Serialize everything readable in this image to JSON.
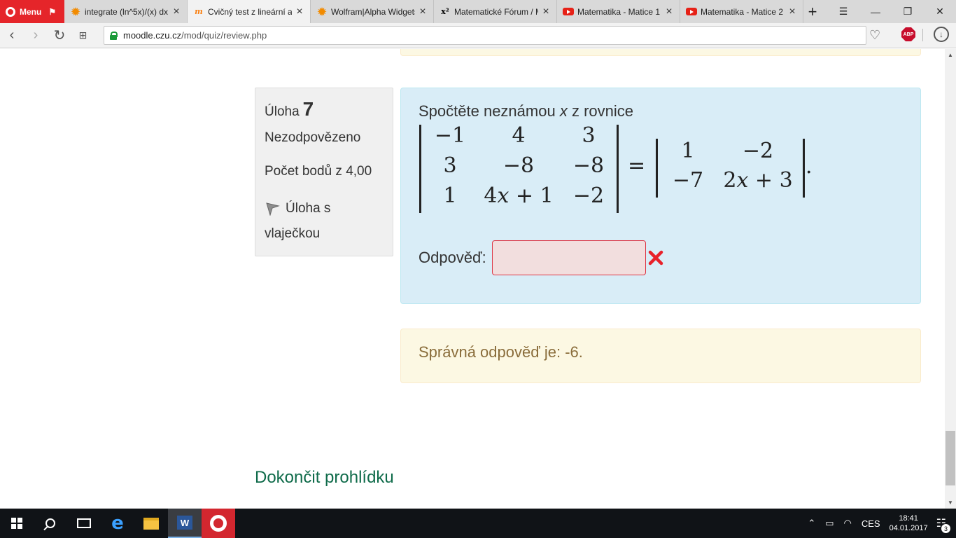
{
  "browser": {
    "menu_label": "Menu",
    "tabs": [
      {
        "title": "integrate (ln^5x)/(x) dx",
        "icon": "wolfram-sun-icon"
      },
      {
        "title": "Cvičný test z lineární algebry",
        "icon": "moodle-icon",
        "active": true
      },
      {
        "title": "Wolfram|Alpha Widgets",
        "icon": "wolfram-sun-icon"
      },
      {
        "title": "Matematické Fórum / Matice",
        "icon": "x2-icon"
      },
      {
        "title": "Matematika - Matice 1",
        "icon": "youtube-icon"
      },
      {
        "title": "Matematika - Matice 2",
        "icon": "youtube-icon"
      }
    ],
    "url_host": "moodle.czu.cz",
    "url_path": "/mod/quiz/review.php"
  },
  "question": {
    "label": "Úloha",
    "number": "7",
    "state": "Nezodpovězeno",
    "grade": "Počet bodů z 4,00",
    "flag_label_line1": "Úloha s",
    "flag_label_line2": "vlaječkou",
    "text_before": "Spočtěte neznámou",
    "text_var": "x",
    "text_after": "z rovnice",
    "matrix_left": [
      [
        "−1",
        "4",
        "3"
      ],
      [
        "3",
        "−8",
        "−8"
      ],
      [
        "1",
        "4x + 1",
        "−2"
      ]
    ],
    "matrix_right": [
      [
        "1",
        "−2"
      ],
      [
        "−7",
        "2x + 3"
      ]
    ],
    "equals": "=",
    "end_dot": ".",
    "answer_label": "Odpověď:",
    "answer_value": "",
    "right_answer": "Správná odpověď je: -6."
  },
  "footer": {
    "finish_review": "Dokončit prohlídku"
  },
  "taskbar": {
    "language": "CES",
    "time": "18:41",
    "date": "04.01.2017",
    "notifications": "3"
  },
  "colors": {
    "formulation_bg": "#d9edf7",
    "outcome_bg": "#fcf8e3",
    "incorrect_input_bg": "#f2dede",
    "incorrect_border": "#dc3545",
    "link_color": "#0f6b4a",
    "opera_red": "#e5252a"
  }
}
